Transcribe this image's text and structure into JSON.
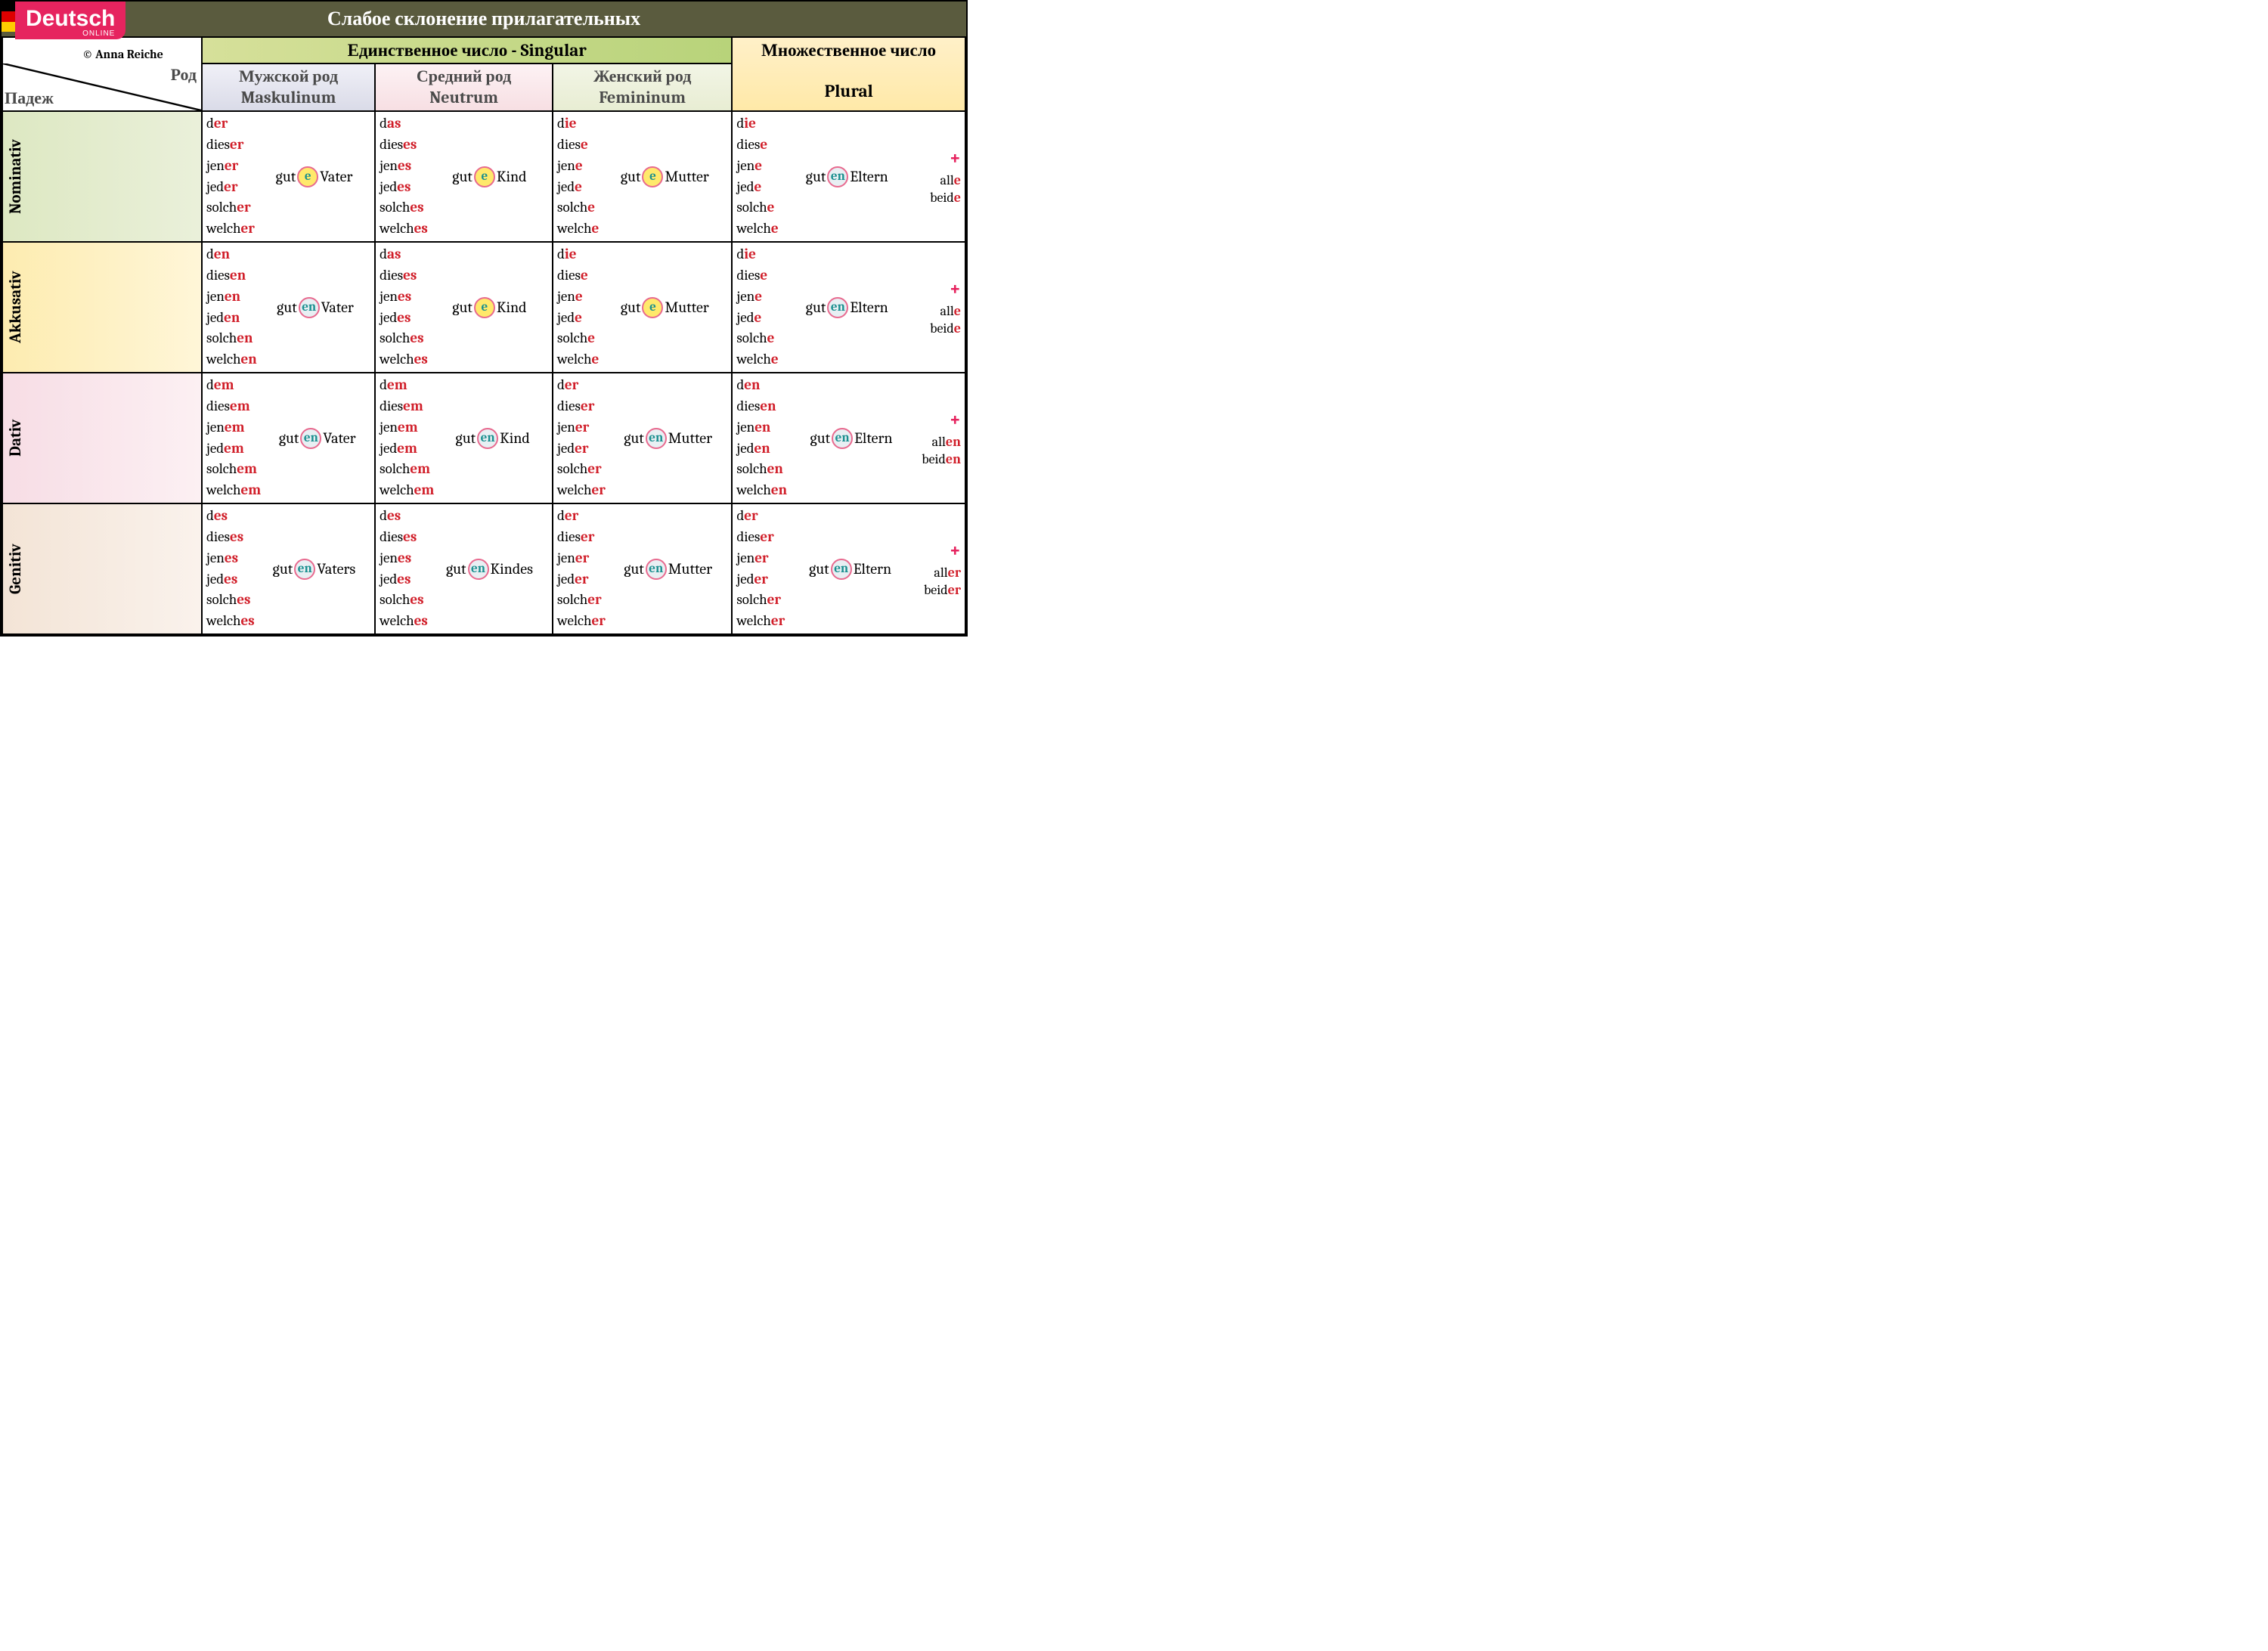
{
  "title": "Слабое склонение прилагательных",
  "logo": "Deutsch",
  "logo_sub": "ONLINE",
  "credit": "© Anna Reiche",
  "headers": {
    "singular": "Единственное число    -    Singular",
    "plural_ru": "Множественное число",
    "plural_de": "Plural",
    "rod": "Род",
    "padezh": "Падеж",
    "mask_ru": "Мужской род",
    "mask_de": "Maskulinum",
    "neut_ru": "Средний род",
    "neut_de": "Neutrum",
    "fem_ru": "Женский род",
    "fem_de": "Femininum"
  },
  "cases": [
    "Nominativ",
    "Akkusativ",
    "Dativ",
    "Genitiv"
  ],
  "det_stems": [
    "d",
    "dies",
    "jen",
    "jed",
    "solch",
    "welch"
  ],
  "adj_stem": "gut",
  "table": {
    "Nominativ": {
      "mask": {
        "det_end": "er",
        "det_first": "er",
        "adj_end": "e",
        "bubble": "e",
        "noun": "Vater"
      },
      "neut": {
        "det_end": "es",
        "det_first": "as",
        "adj_end": "e",
        "bubble": "e",
        "noun": "Kind"
      },
      "fem": {
        "det_end": "e",
        "det_first": "ie",
        "adj_end": "e",
        "bubble": "e",
        "noun": "Mutter"
      },
      "plural": {
        "det_end": "e",
        "det_first": "ie",
        "adj_end": "en",
        "bubble": "en",
        "noun": "Eltern",
        "extra": [
          {
            "stem": "all",
            "end": "e"
          },
          {
            "stem": "beid",
            "end": "e"
          }
        ]
      }
    },
    "Akkusativ": {
      "mask": {
        "det_end": "en",
        "det_first": "en",
        "adj_end": "en",
        "bubble": "en",
        "noun": "Vater"
      },
      "neut": {
        "det_end": "es",
        "det_first": "as",
        "adj_end": "e",
        "bubble": "e",
        "noun": "Kind"
      },
      "fem": {
        "det_end": "e",
        "det_first": "ie",
        "adj_end": "e",
        "bubble": "e",
        "noun": "Mutter"
      },
      "plural": {
        "det_end": "e",
        "det_first": "ie",
        "adj_end": "en",
        "bubble": "en",
        "noun": "Eltern",
        "extra": [
          {
            "stem": "all",
            "end": "e"
          },
          {
            "stem": "beid",
            "end": "e"
          }
        ]
      }
    },
    "Dativ": {
      "mask": {
        "det_end": "em",
        "det_first": "em",
        "adj_end": "en",
        "bubble": "en",
        "noun": "Vater"
      },
      "neut": {
        "det_end": "em",
        "det_first": "em",
        "adj_end": "en",
        "bubble": "en",
        "noun": "Kind"
      },
      "fem": {
        "det_end": "er",
        "det_first": "er",
        "adj_end": "en",
        "bubble": "en",
        "noun": "Mutter"
      },
      "plural": {
        "det_end": "en",
        "det_first": "en",
        "adj_end": "en",
        "bubble": "en",
        "noun": "Eltern",
        "extra": [
          {
            "stem": "all",
            "end": "en"
          },
          {
            "stem": "beid",
            "end": "en"
          }
        ]
      }
    },
    "Genitiv": {
      "mask": {
        "det_end": "es",
        "det_first": "es",
        "adj_end": "en",
        "bubble": "en",
        "noun": "Vaters"
      },
      "neut": {
        "det_end": "es",
        "det_first": "es",
        "adj_end": "en",
        "bubble": "en",
        "noun": "Kindes"
      },
      "fem": {
        "det_end": "er",
        "det_first": "er",
        "adj_end": "en",
        "bubble": "en",
        "noun": "Mutter"
      },
      "plural": {
        "det_end": "er",
        "det_first": "er",
        "adj_end": "en",
        "bubble": "en",
        "noun": "Eltern",
        "extra": [
          {
            "stem": "all",
            "end": "er"
          },
          {
            "stem": "beid",
            "end": "er"
          }
        ]
      }
    }
  },
  "plus": "+"
}
